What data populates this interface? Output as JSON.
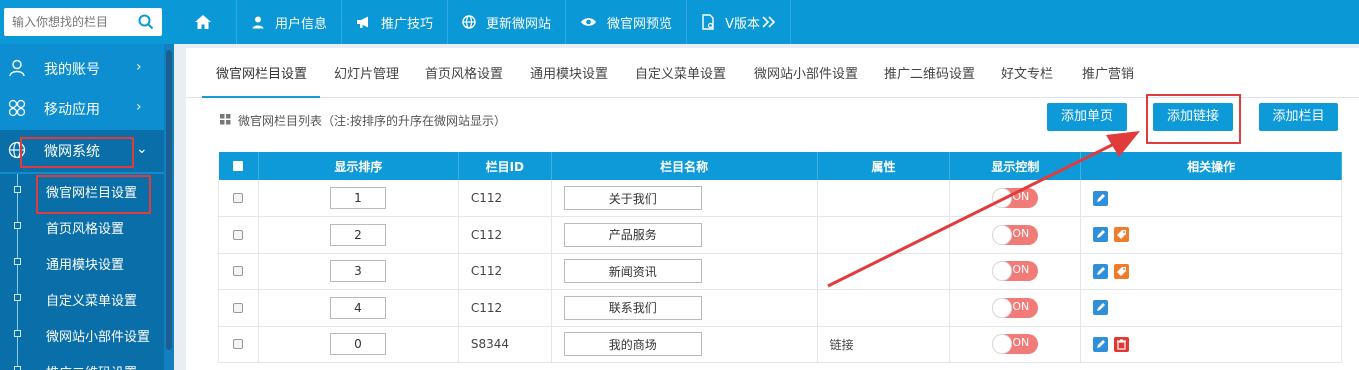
{
  "search": {
    "placeholder": "输入你想找的栏目"
  },
  "topnav": [
    {
      "label": "用户信息",
      "icon": "user-icon"
    },
    {
      "label": "推广技巧",
      "icon": "megaphone-icon"
    },
    {
      "label": "更新微网站",
      "icon": "globe-icon"
    },
    {
      "label": "微官网预览",
      "icon": "eye-icon"
    },
    {
      "label": "V版本",
      "icon": "document-icon"
    }
  ],
  "sidebar": {
    "groups": [
      {
        "label": "我的账号",
        "icon": "user-icon",
        "chevron": "›"
      },
      {
        "label": "移动应用",
        "icon": "apps-icon",
        "chevron": "›"
      },
      {
        "label": "微网系统",
        "icon": "globe-icon",
        "chevron": "⌄"
      }
    ],
    "sub_items": [
      {
        "label": "微官网栏目设置"
      },
      {
        "label": "首页风格设置"
      },
      {
        "label": "通用模块设置"
      },
      {
        "label": "自定义菜单设置"
      },
      {
        "label": "微网站小部件设置"
      },
      {
        "label": "推广二维码设置"
      }
    ]
  },
  "tabs": [
    {
      "label": "微官网栏目设置"
    },
    {
      "label": "幻灯片管理"
    },
    {
      "label": "首页风格设置"
    },
    {
      "label": "通用模块设置"
    },
    {
      "label": "自定义菜单设置"
    },
    {
      "label": "微网站小部件设置"
    },
    {
      "label": "推广二维码设置"
    },
    {
      "label": "好文专栏"
    },
    {
      "label": "推广营销"
    }
  ],
  "list": {
    "title": "微官网栏目列表（注:按排序的升序在微网站显示）",
    "buttons": {
      "add_page": "添加单页",
      "add_link": "添加链接",
      "add_column": "添加栏目"
    }
  },
  "table": {
    "headers": {
      "sort": "显示排序",
      "id": "栏目ID",
      "name": "栏目名称",
      "attr": "属性",
      "display": "显示控制",
      "ops": "相关操作"
    },
    "rows": [
      {
        "sort": "1",
        "id": "C112",
        "name": "关于我们",
        "attr": "",
        "toggle": "ON",
        "ops": [
          "edit-icon"
        ]
      },
      {
        "sort": "2",
        "id": "C112",
        "name": "产品服务",
        "attr": "",
        "toggle": "ON",
        "ops": [
          "edit-icon",
          "tag-icon"
        ]
      },
      {
        "sort": "3",
        "id": "C112",
        "name": "新闻资讯",
        "attr": "",
        "toggle": "ON",
        "ops": [
          "edit-icon",
          "tag-icon"
        ]
      },
      {
        "sort": "4",
        "id": "C112",
        "name": "联系我们",
        "attr": "",
        "toggle": "ON",
        "ops": [
          "edit-icon"
        ]
      },
      {
        "sort": "0",
        "id": "S8344",
        "name": "我的商场",
        "attr": "链接",
        "toggle": "ON",
        "ops": [
          "edit-icon",
          "trash-icon"
        ]
      }
    ]
  },
  "colors": {
    "topbar": "#0b98d6",
    "sidebar": "#0c8ed0",
    "accent": "#0e9ad9",
    "toggle_on": "#f17b77",
    "highlight": "#e23b3b"
  }
}
